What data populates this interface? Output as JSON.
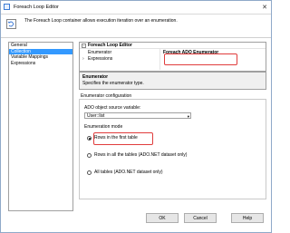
{
  "window": {
    "title": "Foreach Loop Editor",
    "close_icon": "close-icon"
  },
  "description": {
    "icon": "foreach-loop-icon",
    "text": "The Foreach Loop container allows execution iteration over an enumeration."
  },
  "nav": {
    "items": [
      {
        "label": "General",
        "selected": false
      },
      {
        "label": "Collection",
        "selected": true
      },
      {
        "label": "Variable Mappings",
        "selected": false
      },
      {
        "label": "Expressions",
        "selected": false
      }
    ]
  },
  "grid": {
    "header": "Foreach Loop Editor",
    "rows": [
      {
        "key": "Enumerator",
        "value": "Foreach ADO Enumerator"
      },
      {
        "key": "Expressions",
        "value": ""
      }
    ]
  },
  "help": {
    "title": "Enumerator",
    "text": "Specifies the enumerator type."
  },
  "config": {
    "section_title": "Enumerator configuration",
    "source_label": "ADO object source variable:",
    "source_value": "User::list",
    "mode_label": "Enumeration mode",
    "modes": [
      {
        "label": "Rows in the first table",
        "checked": true
      },
      {
        "label": "Rows in all the tables (ADO.NET dataset only)",
        "checked": false
      },
      {
        "label": "All tables (ADO.NET dataset only)",
        "checked": false
      }
    ]
  },
  "buttons": {
    "ok": "OK",
    "cancel": "Cancel",
    "help": "Help"
  },
  "colors": {
    "selection": "#3399ff",
    "highlight": "#e03c3c"
  }
}
